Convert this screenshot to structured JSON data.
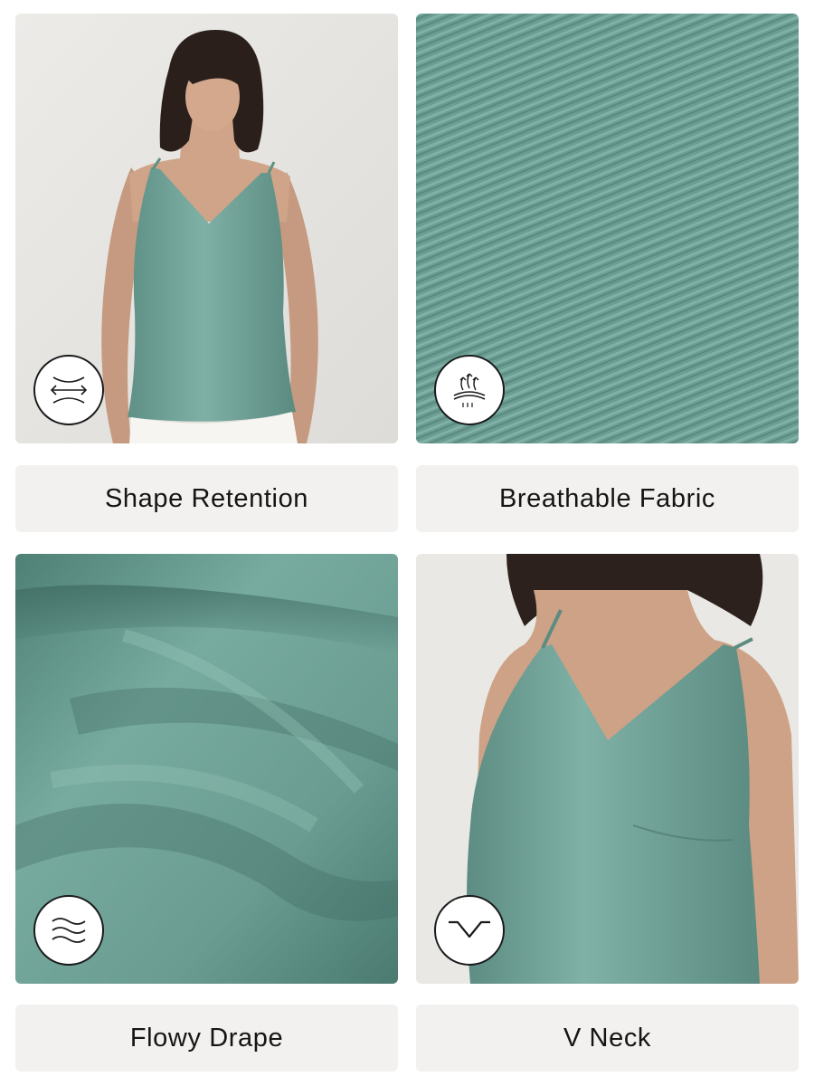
{
  "features": [
    {
      "label": "Shape Retention",
      "icon": "stretch-arrows-icon"
    },
    {
      "label": "Breathable Fabric",
      "icon": "breathable-airflow-icon"
    },
    {
      "label": "Flowy Drape",
      "icon": "wave-lines-icon"
    },
    {
      "label": "V Neck",
      "icon": "v-neck-icon"
    }
  ],
  "colors": {
    "fabric": "#6f9f94",
    "fabric_dark": "#4d7c72",
    "background_studio": "#e8e7e3",
    "label_bg": "#f2f1ef",
    "label_text": "#151515"
  }
}
